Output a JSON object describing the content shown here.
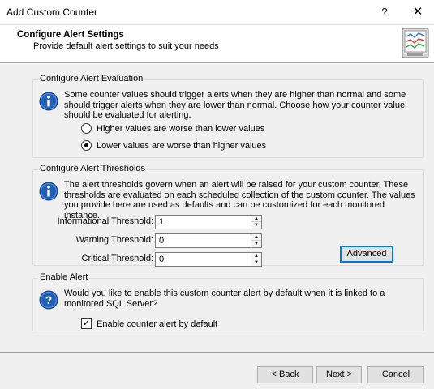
{
  "window": {
    "title": "Add Custom Counter",
    "help_label": "?",
    "close_label": "✕"
  },
  "header": {
    "title": "Configure Alert Settings",
    "subtitle": "Provide default alert settings to suit your needs",
    "icon": "monitor-chart-icon"
  },
  "evaluation": {
    "group_label": "Configure Alert Evaluation",
    "icon": "info-icon",
    "description": "Some counter values should trigger alerts when they are higher than normal and some should trigger alerts when they are lower than normal. Choose how your counter value should be evaluated for alerting.",
    "options": [
      {
        "label": "Higher values are worse than lower values",
        "selected": false
      },
      {
        "label": "Lower values are worse than higher values",
        "selected": true
      }
    ]
  },
  "thresholds": {
    "group_label": "Configure Alert Thresholds",
    "icon": "info-icon",
    "description": "The alert thresholds govern when an alert will be raised for your custom counter. These thresholds are evaluated on each scheduled collection of the custom counter. The values you provide here are used as defaults and can be customized for each monitored instance.",
    "fields": [
      {
        "label": "Informational Threshold:",
        "value": "1"
      },
      {
        "label": "Warning Threshold:",
        "value": "0"
      },
      {
        "label": "Critical Threshold:",
        "value": "0"
      }
    ],
    "advanced_label": "Advanced"
  },
  "enable": {
    "group_label": "Enable Alert",
    "icon": "question-icon",
    "question": "Would you like to enable this custom counter alert by default when it is linked to a monitored SQL Server?",
    "checkbox_label": "Enable counter alert by default",
    "checked": true
  },
  "footer": {
    "back_label": "< Back",
    "next_label": "Next >",
    "cancel_label": "Cancel"
  },
  "colors": {
    "accent": "#0078d7",
    "info_icon_blue": "#1f5fb8",
    "dialog_bg": "#f0f0f0"
  }
}
